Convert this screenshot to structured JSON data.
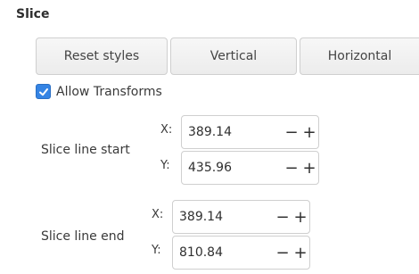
{
  "section_title": "Slice",
  "buttons": {
    "reset": "Reset styles",
    "vertical": "Vertical",
    "horizontal": "Horizontal"
  },
  "allow_transforms": {
    "label": "Allow Transforms",
    "checked": true
  },
  "slice_start": {
    "label": "Slice line start",
    "x_label": "X:",
    "x_value": "389.14",
    "y_label": "Y:",
    "y_value": "435.96"
  },
  "slice_end": {
    "label": "Slice line end",
    "x_label": "X:",
    "x_value": "389.14",
    "y_label": "Y:",
    "y_value": "810.84"
  },
  "spin_controls": {
    "minus": "−",
    "plus": "+"
  },
  "colors": {
    "accent": "#3584e4"
  }
}
